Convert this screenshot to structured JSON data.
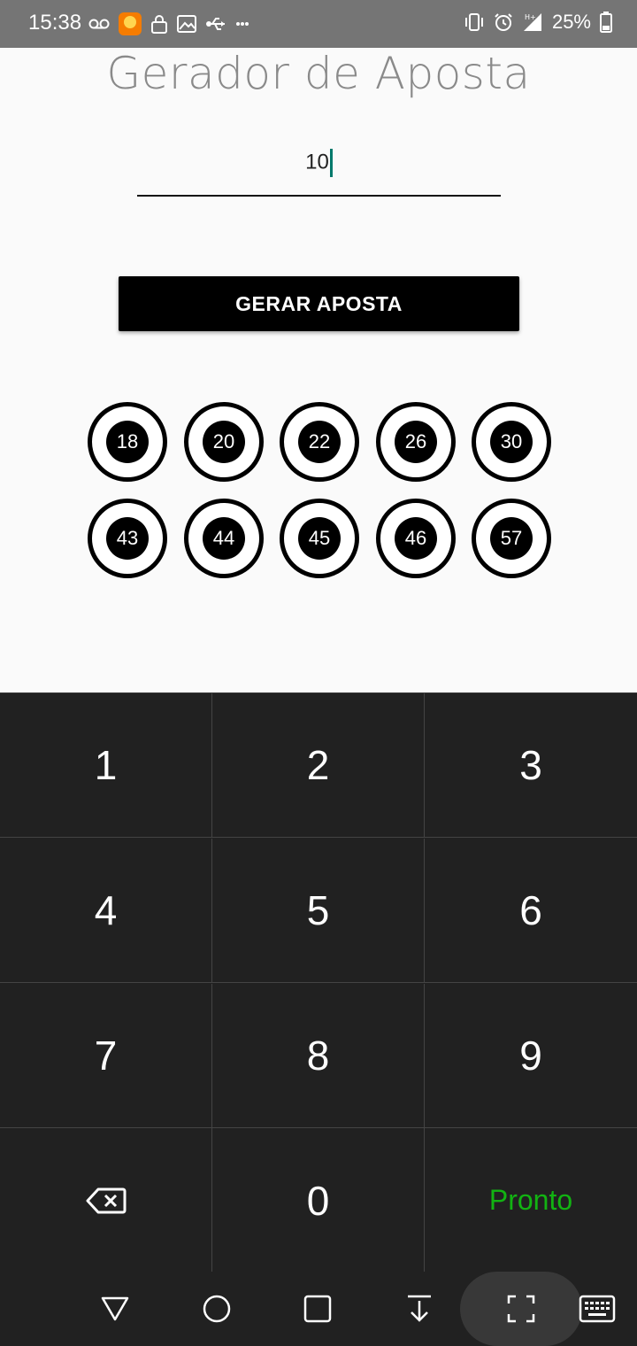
{
  "status_bar": {
    "time": "15:38",
    "battery": "25%",
    "icons_left": [
      "voicemail-icon",
      "app-notification-icon",
      "lock-icon",
      "image-icon",
      "usb-icon",
      "more-icon"
    ],
    "icons_right": [
      "vibrate-icon",
      "alarm-icon",
      "signal-icon",
      "battery-icon"
    ]
  },
  "app": {
    "title": "Gerador de Aposta",
    "input_value": "10",
    "button_label": "GERAR APOSTA",
    "numbers": [
      "18",
      "20",
      "22",
      "26",
      "30",
      "43",
      "44",
      "45",
      "46",
      "57"
    ]
  },
  "keyboard": {
    "keys": [
      "1",
      "2",
      "3",
      "4",
      "5",
      "6",
      "7",
      "8",
      "9",
      "backspace",
      "0",
      "Pronto"
    ],
    "done_label": "Pronto",
    "done_color": "#12b312"
  },
  "navbar": {
    "buttons": [
      "back-icon",
      "home-icon",
      "recents-icon",
      "notification-pull-icon",
      "screenshot-icon",
      "keyboard-switch-icon"
    ]
  },
  "colors": {
    "status_bar": "#757575",
    "accent_caret": "#00796b",
    "keyboard_bg": "#212121"
  }
}
